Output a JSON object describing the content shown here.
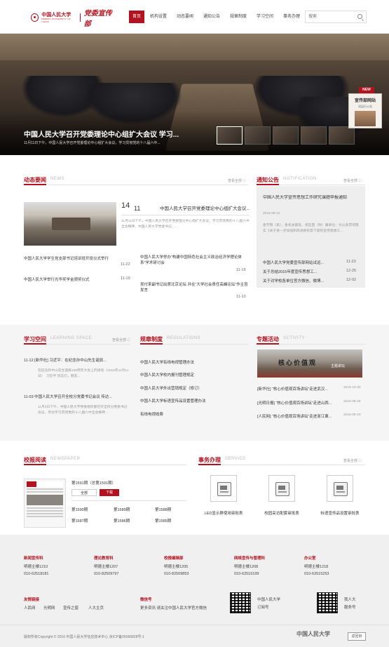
{
  "header": {
    "logo_name": "中国人民大学",
    "logo_sub": "RENMIN UNIVERSITY OF CHINA",
    "dept": "党委宣传部",
    "nav": [
      "首页",
      "机构设置",
      "动态要闻",
      "通知公告",
      "规章制度",
      "学习空间",
      "事务办理"
    ],
    "search_placeholder": "搜索"
  },
  "hero": {
    "title": "中国人民大学召开党委理论中心组扩大会议 学习...",
    "subtitle": "11月11日下午，中国人民大学召开党委理论中心组扩大会议，学习贯彻党的十八届六中...",
    "badge": "NEW",
    "promo_title": "宣传部网站",
    "promo_sub": "试运行公告"
  },
  "news": {
    "title": "动态要闻",
    "en": "NEWS",
    "more": "查看全部 ⓘ",
    "featured": {
      "day": "14",
      "month": "11",
      "title": "中国人民大学召开党委理论中心组扩大会议...",
      "desc": "11月11日下午，中国人民大学召开党委理论中心组扩大会议，学习贯彻党的十八届六中全会精神。中国人民大学党委书记......"
    },
    "left_items": [
      {
        "text": "中国人民大学学生党支部书记培训班开班仪式举行",
        "date": "11-22"
      },
      {
        "text": "中国人民大学举行光华奖学金颁奖仪式",
        "date": "11-19"
      }
    ],
    "right_items": [
      {
        "text": "中国人民大学举办“构建中国特色社会主义政治经济学理论体系”学术研讨会",
        "date": "11-15"
      },
      {
        "text": "吴付来副书记出席北京论坛 并在“大学社会责任高峰论坛”作主旨发言",
        "date": "11-10"
      }
    ]
  },
  "notice": {
    "title": "通知公告",
    "en": "NOTIFICATION",
    "more": "查看全部 ⓘ",
    "featured_title": "中国人民大学宣传思想工作研究课题申报通知",
    "featured_date": "2016-09-12",
    "featured_desc": "各学院（系）、各机关部处、校区直（附）属单位：为认真贯彻落实《关于进一步加强和改进新形势下高校宣传思想工...",
    "items": [
      {
        "text": "中国人民大学党委宣传部网站试运...",
        "date": "11-23"
      },
      {
        "text": "关于总结2015年度宣传思想工...",
        "date": "12-25"
      },
      {
        "text": "关于对学校各单位官方微信、微博...",
        "date": "12-02"
      }
    ]
  },
  "study": {
    "title": "学习空间",
    "en": "LEARNING  SPACE",
    "more": "查看全部 ⓘ",
    "items": [
      {
        "head": "11-12 [新华社] 习近平：在纪念孙中山先生诞辰...",
        "desc": "在纪念孙中山先生诞辰150周年大会上的讲话（2016年11月11日）　习近平 同志们，朋友..."
      },
      {
        "head": "11-03 中国人民大学召开全校分党委书记会议 传达...",
        "desc": "11月2日下午，中国人民大学党委组织部召开全校分党委书记会议，传达学习贯彻党的十八届六中全会精神..."
      }
    ]
  },
  "rules": {
    "title": "规章制度",
    "en": "REGULATIONS",
    "items": [
      "中国人民大学有线电视管理办法",
      "中国人民大学校内报刊管理规定",
      "中国人民大学外出营销规定（修订）",
      "中国人民大学标语宣传品设置管理办法",
      "有线电视收费"
    ]
  },
  "activity": {
    "title": "专题活动",
    "en": "ACTIVITY",
    "banner_text": "核心价值观",
    "banner_sub": "主题讲坛",
    "items": [
      {
        "text": "[新华社] “核心价值观百场讲坛”走进武汉...",
        "date": "2016-10-30"
      },
      {
        "text": "[光明日报] “核心价值观百场讲坛”走进山西...",
        "date": "2016-09-26"
      },
      {
        "text": "[人民网] “核心价值观百场讲坛”走进浙江東...",
        "date": "2016-09-23"
      }
    ]
  },
  "paper": {
    "title": "校报阅读",
    "en": "NEWSPAPER",
    "issue": "第1591期（总第1591期）",
    "all_btn": "全部",
    "dl_btn": "下载",
    "issues": [
      "第1590期",
      "第1589期",
      "第1588期",
      "第1587期",
      "第1586期",
      "第1585期"
    ]
  },
  "service": {
    "title": "事务办理",
    "en": "SERVICE",
    "more": "查看全部 ⓘ",
    "items": [
      "LED显示屏使用审批表",
      "校园采访配套审批表",
      "标语宣传品设置审批表"
    ]
  },
  "footer": {
    "contacts": [
      {
        "head": "新闻宣传科",
        "name": "明德主楼1210",
        "phone": "010-62518181"
      },
      {
        "head": "理论教育科",
        "name": "明德主楼1207",
        "phone": "010-82509797"
      },
      {
        "head": "校报编辑部",
        "name": "明德主楼1205",
        "phone": "010-82509853"
      },
      {
        "head": "网络宣传与管理科",
        "name": "明德主楼1208",
        "phone": "010-62516199"
      },
      {
        "head": "办公室",
        "name": "明德主楼1218",
        "phone": "010-62515253"
      }
    ],
    "links_head": "友情链接",
    "links": [
      "人民网",
      "光明网",
      "宣传之窗",
      "人大主页"
    ],
    "wechat_head": "微信号",
    "wechat_text": "更多资讯 请关注中国人民大学官方微信",
    "qr1_name": "中国人民大学",
    "qr1_sub": "订阅号",
    "qr2_name": "我人大",
    "qr2_sub": "服务号",
    "copyright": "版权所有Copyright © 2016 中国人民大学信息技术中心 京ICP备05066828号-1",
    "logo": "中国人民大学",
    "oldsite": "返回旧"
  },
  "colors": {
    "accent": "#b3121f",
    "band": "#f5f5f5",
    "footer": "#f0f0f0"
  }
}
